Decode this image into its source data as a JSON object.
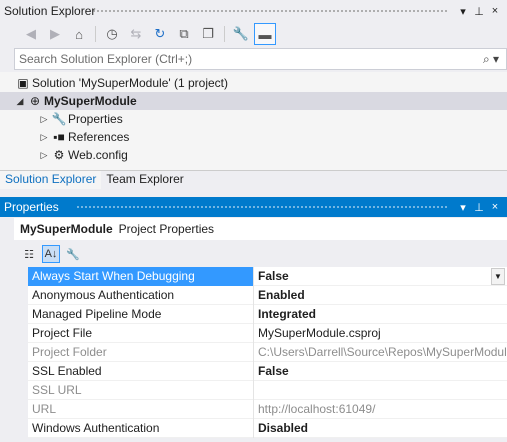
{
  "solution_explorer": {
    "title": "Solution Explorer",
    "title_icons": [
      "▾",
      "⊥",
      "×"
    ],
    "search_placeholder": "Search Solution Explorer (Ctrl+;)",
    "tree": [
      {
        "label": "Solution 'MySuperModule' (1 project)",
        "icon": "solution-icon"
      },
      {
        "label": "MySuperModule",
        "icon": "web-project-icon",
        "selected": true
      },
      {
        "label": "Properties",
        "icon": "wrench-icon"
      },
      {
        "label": "References",
        "icon": "references-icon"
      },
      {
        "label": "Web.config",
        "icon": "config-file-icon"
      }
    ],
    "tabs": [
      "Solution Explorer",
      "Team Explorer"
    ]
  },
  "properties": {
    "title": "Properties",
    "title_icons": [
      "▾",
      "⊥",
      "×"
    ],
    "object_name": "MySuperModule",
    "object_type": "Project Properties",
    "rows": [
      {
        "name": "Always Start When Debugging",
        "value": "False",
        "bold": true,
        "selected": true
      },
      {
        "name": "Anonymous Authentication",
        "value": "Enabled",
        "bold": true
      },
      {
        "name": "Managed Pipeline Mode",
        "value": "Integrated",
        "bold": true
      },
      {
        "name": "Project File",
        "value": "MySuperModule.csproj",
        "bold": false
      },
      {
        "name": "Project Folder",
        "value": "C:\\Users\\Darrell\\Source\\Repos\\MySuperModule",
        "bold": false,
        "disabled": true
      },
      {
        "name": "SSL Enabled",
        "value": "False",
        "bold": true
      },
      {
        "name": "SSL URL",
        "value": "",
        "bold": false,
        "disabled": true
      },
      {
        "name": "URL",
        "value": "http://localhost:61049/",
        "bold": false,
        "disabled": true
      },
      {
        "name": "Windows Authentication",
        "value": "Disabled",
        "bold": true
      }
    ]
  },
  "colors": {
    "accent": "#007acc",
    "selection": "#3399ff",
    "tab_active_text": "#0e70c0"
  }
}
